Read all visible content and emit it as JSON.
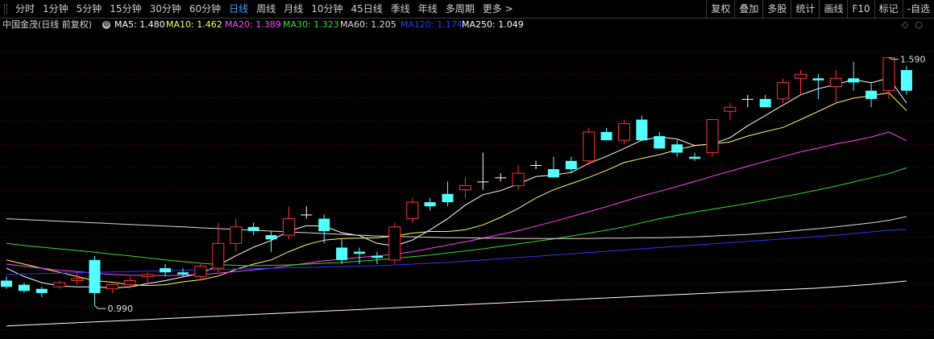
{
  "toolbar": {
    "periods": [
      "分时",
      "1分钟",
      "5分钟",
      "15分钟",
      "30分钟",
      "60分钟",
      "日线",
      "周线",
      "月线",
      "10分钟",
      "45日线",
      "季线",
      "年线",
      "多周期",
      "更多 >"
    ],
    "active_period": "日线",
    "right_buttons": [
      "复权",
      "叠加",
      "多股",
      "统计",
      "画线",
      "F10",
      "标记",
      "-自选"
    ]
  },
  "infobar": {
    "stock_label": "中国金茂(日线 前复权)",
    "ma_labels": [
      {
        "text": "MA5: 1.480",
        "color": "#ffffff"
      },
      {
        "text": "MA10: 1.462",
        "color": "#ffff66"
      },
      {
        "text": "MA20: 1.389",
        "color": "#ff44ff"
      },
      {
        "text": "MA30: 1.323",
        "color": "#33dd33"
      },
      {
        "text": "MA60: 1.205",
        "color": "#dddddd"
      },
      {
        "text": "MA120: 1.174",
        "color": "#3333ff"
      },
      {
        "text": "MA250: 1.049",
        "color": "#ffffff"
      }
    ],
    "window_icons": [
      "◇",
      "○"
    ]
  },
  "colors": {
    "up": "#ff3333",
    "down": "#54ffff",
    "grid": "#5a0a0a"
  },
  "annotations": {
    "high": "1.590",
    "low": "0.990"
  },
  "chart_data": {
    "type": "candlestick",
    "ylim": [
      0.93,
      1.64
    ],
    "candles": [
      [
        1.05,
        1.06,
        1.03,
        1.035
      ],
      [
        1.04,
        1.045,
        1.02,
        1.025
      ],
      [
        1.03,
        1.035,
        1.01,
        1.02
      ],
      [
        1.035,
        1.05,
        1.03,
        1.045
      ],
      [
        1.05,
        1.07,
        1.04,
        1.055
      ],
      [
        1.1,
        1.11,
        0.99,
        1.02
      ],
      [
        1.03,
        1.04,
        1.02,
        1.04
      ],
      [
        1.04,
        1.06,
        1.03,
        1.05
      ],
      [
        1.06,
        1.07,
        1.04,
        1.065
      ],
      [
        1.08,
        1.09,
        1.06,
        1.07
      ],
      [
        1.07,
        1.08,
        1.06,
        1.065
      ],
      [
        1.06,
        1.09,
        1.05,
        1.085
      ],
      [
        1.08,
        1.19,
        1.07,
        1.14
      ],
      [
        1.14,
        1.2,
        1.12,
        1.18
      ],
      [
        1.18,
        1.19,
        1.16,
        1.17
      ],
      [
        1.16,
        1.17,
        1.12,
        1.15
      ],
      [
        1.16,
        1.23,
        1.15,
        1.2
      ],
      [
        1.21,
        1.23,
        1.2,
        1.21
      ],
      [
        1.2,
        1.21,
        1.14,
        1.17
      ],
      [
        1.13,
        1.15,
        1.09,
        1.1
      ],
      [
        1.12,
        1.13,
        1.09,
        1.115
      ],
      [
        1.11,
        1.12,
        1.09,
        1.105
      ],
      [
        1.1,
        1.19,
        1.09,
        1.18
      ],
      [
        1.2,
        1.25,
        1.19,
        1.24
      ],
      [
        1.24,
        1.25,
        1.22,
        1.23
      ],
      [
        1.26,
        1.29,
        1.23,
        1.24
      ],
      [
        1.27,
        1.3,
        1.25,
        1.28
      ],
      [
        1.29,
        1.36,
        1.27,
        1.29
      ],
      [
        1.3,
        1.31,
        1.29,
        1.3
      ],
      [
        1.28,
        1.33,
        1.27,
        1.31
      ],
      [
        1.33,
        1.34,
        1.32,
        1.33
      ],
      [
        1.32,
        1.35,
        1.31,
        1.3
      ],
      [
        1.34,
        1.35,
        1.31,
        1.32
      ],
      [
        1.34,
        1.42,
        1.33,
        1.41
      ],
      [
        1.41,
        1.42,
        1.39,
        1.39
      ],
      [
        1.39,
        1.44,
        1.38,
        1.43
      ],
      [
        1.44,
        1.45,
        1.39,
        1.39
      ],
      [
        1.4,
        1.41,
        1.37,
        1.37
      ],
      [
        1.38,
        1.39,
        1.35,
        1.36
      ],
      [
        1.35,
        1.36,
        1.34,
        1.345
      ],
      [
        1.36,
        1.44,
        1.35,
        1.44
      ],
      [
        1.46,
        1.48,
        1.44,
        1.47
      ],
      [
        1.49,
        1.5,
        1.47,
        1.49
      ],
      [
        1.49,
        1.5,
        1.47,
        1.47
      ],
      [
        1.49,
        1.54,
        1.48,
        1.53
      ],
      [
        1.54,
        1.56,
        1.5,
        1.55
      ],
      [
        1.54,
        1.55,
        1.49,
        1.535
      ],
      [
        1.52,
        1.56,
        1.48,
        1.54
      ],
      [
        1.54,
        1.58,
        1.51,
        1.53
      ],
      [
        1.51,
        1.53,
        1.47,
        1.49
      ],
      [
        1.51,
        1.59,
        1.49,
        1.59
      ],
      [
        1.56,
        1.57,
        1.5,
        1.51
      ]
    ],
    "ma_series": [
      {
        "name": "MA5",
        "color": "#ffffff",
        "values": [
          1.08,
          1.06,
          1.045,
          1.037,
          1.035,
          1.035,
          1.032,
          1.035,
          1.043,
          1.05,
          1.059,
          1.067,
          1.087,
          1.11,
          1.131,
          1.147,
          1.17,
          1.183,
          1.182,
          1.166,
          1.159,
          1.14,
          1.134,
          1.148,
          1.173,
          1.2,
          1.233,
          1.258,
          1.268,
          1.284,
          1.302,
          1.306,
          1.312,
          1.334,
          1.351,
          1.37,
          1.39,
          1.398,
          1.393,
          1.377,
          1.381,
          1.396,
          1.425,
          1.45,
          1.475,
          1.5,
          1.515,
          1.525,
          1.537,
          1.529,
          1.541,
          1.48
        ]
      },
      {
        "name": "MA10",
        "color": "#ffff66",
        "values": [
          1.1,
          1.09,
          1.08,
          1.07,
          1.06,
          1.05,
          1.046,
          1.04,
          1.038,
          1.04,
          1.047,
          1.052,
          1.061,
          1.077,
          1.09,
          1.1,
          1.12,
          1.137,
          1.148,
          1.152,
          1.153,
          1.154,
          1.158,
          1.165,
          1.169,
          1.169,
          1.173,
          1.185,
          1.203,
          1.225,
          1.25,
          1.27,
          1.285,
          1.3,
          1.317,
          1.336,
          1.346,
          1.355,
          1.367,
          1.377,
          1.381,
          1.386,
          1.4,
          1.411,
          1.421,
          1.44,
          1.46,
          1.48,
          1.492,
          1.498,
          1.505,
          1.462
        ]
      },
      {
        "name": "MA20",
        "color": "#ff44ff",
        "values": [
          1.09,
          1.085,
          1.08,
          1.075,
          1.072,
          1.068,
          1.065,
          1.063,
          1.062,
          1.062,
          1.063,
          1.065,
          1.068,
          1.072,
          1.076,
          1.08,
          1.086,
          1.092,
          1.098,
          1.102,
          1.106,
          1.11,
          1.114,
          1.12,
          1.128,
          1.136,
          1.144,
          1.153,
          1.162,
          1.171,
          1.182,
          1.193,
          1.205,
          1.217,
          1.229,
          1.242,
          1.255,
          1.266,
          1.278,
          1.29,
          1.303,
          1.315,
          1.327,
          1.339,
          1.35,
          1.362,
          1.371,
          1.381,
          1.389,
          1.398,
          1.41,
          1.389
        ]
      },
      {
        "name": "MA30",
        "color": "#33dd33",
        "values": [
          1.14,
          1.135,
          1.131,
          1.127,
          1.123,
          1.119,
          1.114,
          1.11,
          1.105,
          1.1,
          1.096,
          1.092,
          1.089,
          1.087,
          1.086,
          1.087,
          1.088,
          1.09,
          1.092,
          1.094,
          1.097,
          1.1,
          1.104,
          1.108,
          1.112,
          1.117,
          1.122,
          1.127,
          1.133,
          1.139,
          1.145,
          1.151,
          1.158,
          1.165,
          1.172,
          1.18,
          1.19,
          1.2,
          1.208,
          1.216,
          1.223,
          1.23,
          1.237,
          1.245,
          1.253,
          1.261,
          1.27,
          1.279,
          1.289,
          1.299,
          1.309,
          1.323
        ]
      },
      {
        "name": "MA60",
        "color": "#dddddd",
        "values": [
          1.2,
          1.198,
          1.196,
          1.194,
          1.192,
          1.19,
          1.188,
          1.186,
          1.184,
          1.182,
          1.18,
          1.178,
          1.176,
          1.174,
          1.172,
          1.17,
          1.168,
          1.166,
          1.164,
          1.162,
          1.16,
          1.158,
          1.157,
          1.156,
          1.155,
          1.154,
          1.154,
          1.153,
          1.153,
          1.152,
          1.152,
          1.152,
          1.152,
          1.152,
          1.153,
          1.153,
          1.154,
          1.154,
          1.155,
          1.156,
          1.158,
          1.16,
          1.162,
          1.165,
          1.168,
          1.172,
          1.176,
          1.18,
          1.185,
          1.19,
          1.196,
          1.205
        ]
      },
      {
        "name": "MA120",
        "color": "#3333ff",
        "values": [
          1.065,
          1.066,
          1.067,
          1.068,
          1.069,
          1.07,
          1.071,
          1.072,
          1.073,
          1.074,
          1.075,
          1.076,
          1.077,
          1.078,
          1.079,
          1.08,
          1.081,
          1.082,
          1.083,
          1.084,
          1.085,
          1.086,
          1.088,
          1.09,
          1.092,
          1.094,
          1.097,
          1.1,
          1.103,
          1.106,
          1.109,
          1.112,
          1.115,
          1.118,
          1.121,
          1.124,
          1.127,
          1.13,
          1.133,
          1.136,
          1.139,
          1.142,
          1.145,
          1.148,
          1.151,
          1.154,
          1.157,
          1.16,
          1.164,
          1.168,
          1.172,
          1.174
        ]
      },
      {
        "name": "MA250",
        "color": "#ffffff",
        "values": [
          0.94,
          0.942,
          0.944,
          0.946,
          0.948,
          0.95,
          0.952,
          0.954,
          0.956,
          0.958,
          0.96,
          0.962,
          0.964,
          0.966,
          0.968,
          0.97,
          0.972,
          0.974,
          0.976,
          0.978,
          0.98,
          0.982,
          0.984,
          0.986,
          0.988,
          0.99,
          0.992,
          0.994,
          0.996,
          0.998,
          1.0,
          1.002,
          1.004,
          1.006,
          1.008,
          1.01,
          1.012,
          1.014,
          1.016,
          1.018,
          1.02,
          1.022,
          1.024,
          1.026,
          1.028,
          1.03,
          1.032,
          1.035,
          1.038,
          1.041,
          1.045,
          1.049
        ]
      }
    ]
  }
}
